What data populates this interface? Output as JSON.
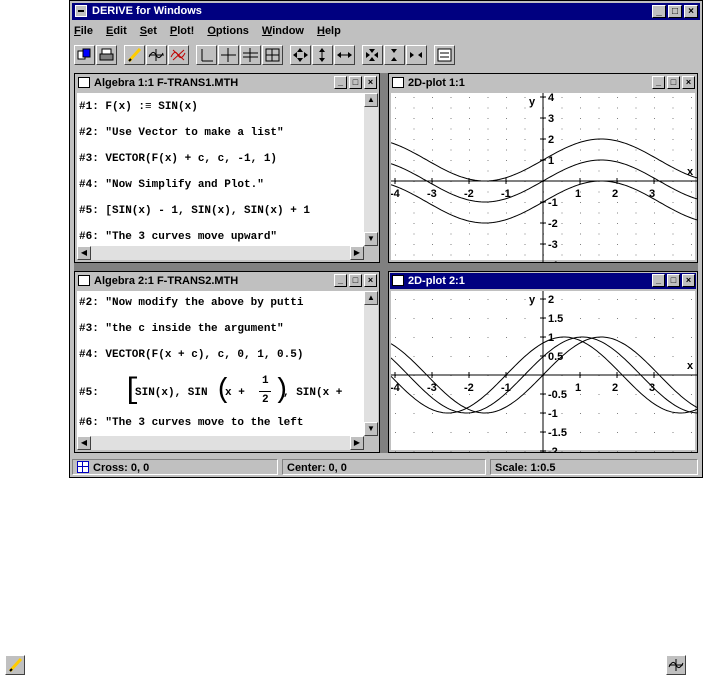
{
  "app": {
    "title": "DERIVE for Windows",
    "menu": [
      "File",
      "Edit",
      "Set",
      "Plot!",
      "Options",
      "Window",
      "Help"
    ]
  },
  "algebra1": {
    "title": "Algebra 1:1  F-TRANS1.MTH",
    "lines": [
      "#1:   F(x) :≡ SIN(x)",
      "#2:   \"Use Vector to make a list\"",
      "#3:   VECTOR(F(x) + c, c, -1, 1)",
      "#4:   \"Now Simplify and Plot.\"",
      "#5:   [SIN(x) - 1, SIN(x), SIN(x) + 1",
      "#6:   \"The 3 curves move upward\""
    ]
  },
  "algebra2": {
    "title": "Algebra 2:1  F-TRANS2.MTH",
    "lines": [
      "#2:   \"Now modify the above by putti",
      "#3:   \"the c inside the argument\"",
      "#4:   VECTOR(F(x + c), c, 0, 1, 0.5)",
      "#6:   \"The 3 curves move to the left"
    ],
    "eq5": {
      "label": "#5:",
      "a": "SIN(x), SIN",
      "b": "x + ",
      "num": "1",
      "den": "2",
      "c": ", SIN(x +"
    }
  },
  "plot1": {
    "title": "2D-plot 1:1",
    "x_ticks": [
      "-4",
      "-3",
      "-2",
      "-1",
      "1",
      "2",
      "3"
    ],
    "y_ticks": [
      "4",
      "3",
      "2",
      "1",
      "-1",
      "-2",
      "-3",
      "-4"
    ],
    "x_label": "x",
    "y_label": "y"
  },
  "plot2": {
    "title": "2D-plot 2:1",
    "x_ticks": [
      "-4",
      "-3",
      "-2",
      "-1",
      "1",
      "2",
      "3"
    ],
    "y_ticks": [
      "2",
      "1.5",
      "1",
      "0.5",
      "-0.5",
      "-1",
      "-1.5",
      "-2"
    ],
    "x_label": "x",
    "y_label": "y"
  },
  "status": {
    "cross": "Cross: 0, 0",
    "center": "Center: 0, 0",
    "scale": "Scale: 1:0.5"
  },
  "icons": {
    "pencil": "pencil-icon",
    "plot": "plot-window-icon"
  }
}
